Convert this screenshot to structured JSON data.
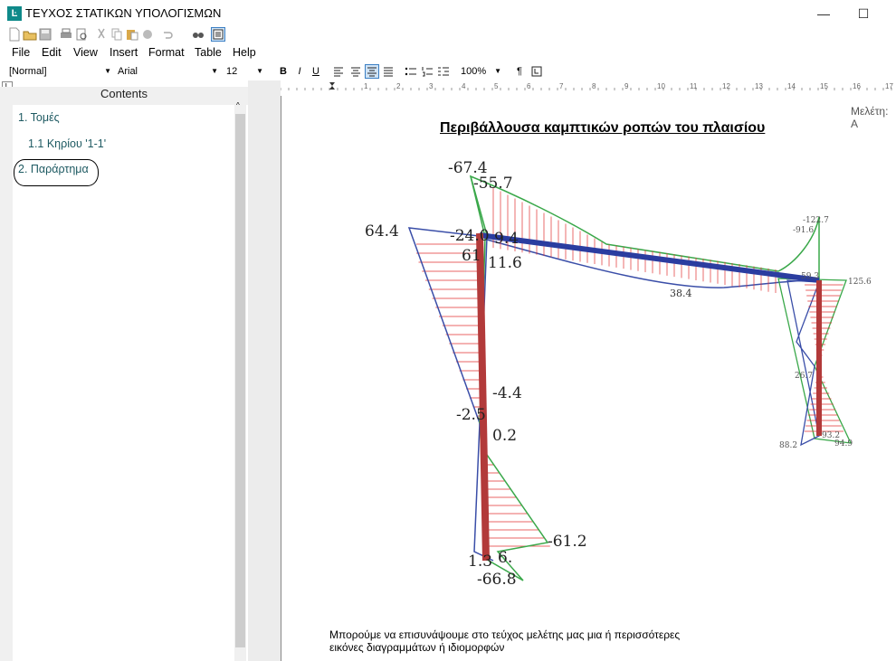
{
  "window": {
    "title": "ΤΕΥΧΟΣ ΣΤΑΤΙΚΩΝ ΥΠΟΛΟΓΙΣΜΩΝ",
    "icon_glyph": "Ŀ",
    "minimize": "—",
    "maximize": "☐"
  },
  "menu": [
    "File",
    "Edit",
    "View",
    "Insert",
    "Format",
    "Table",
    "Help"
  ],
  "format": {
    "style": "[Normal]",
    "font": "Arial",
    "size": "12",
    "zoom": "100%",
    "bold": "B",
    "italic": "I",
    "underline": "U",
    "pilcrow": "¶"
  },
  "contents": {
    "header": "Contents",
    "items": [
      {
        "label": "1. Τομές"
      },
      {
        "label": "1.1 Κηρίου  '1-1'"
      },
      {
        "label": "2. Παράρτημα"
      }
    ]
  },
  "ruler": [
    "1",
    "2",
    "3",
    "4",
    "5",
    "6",
    "7",
    "8",
    "9",
    "10",
    "11",
    "12",
    "13",
    "14",
    "15",
    "16",
    "17"
  ],
  "document": {
    "header_right": "Μελέτη: Α",
    "title": "Περιβάλλουσα καμπτικών ροπών του πλαισίου",
    "caption_line1": "Μπορούμε να επισυνάψουμε στο τεύχος μελέτης μας μια ή περισσότερες",
    "caption_line2": "εικόνες διαγραμμάτων ή ιδιομορφών"
  },
  "diagram": {
    "labels_large": [
      "-67.4",
      "-55.7",
      "64.4",
      "-24.0",
      "9.4",
      "11.6",
      "61",
      "-4.4",
      "-2.5",
      "0.2",
      "-61.2",
      "1.3",
      "6.",
      "-66.8"
    ],
    "labels_small": [
      "38.4",
      "-122.7",
      "-91.6",
      "125.6",
      "26.7",
      "88.2",
      "94.9",
      "93.2",
      "59.3"
    ],
    "colors": {
      "positive": "#3a4ea8",
      "negative": "#3aa84a",
      "hatch": "#e03030",
      "member": "#b23a3a",
      "beam": "#2b3da0"
    }
  }
}
